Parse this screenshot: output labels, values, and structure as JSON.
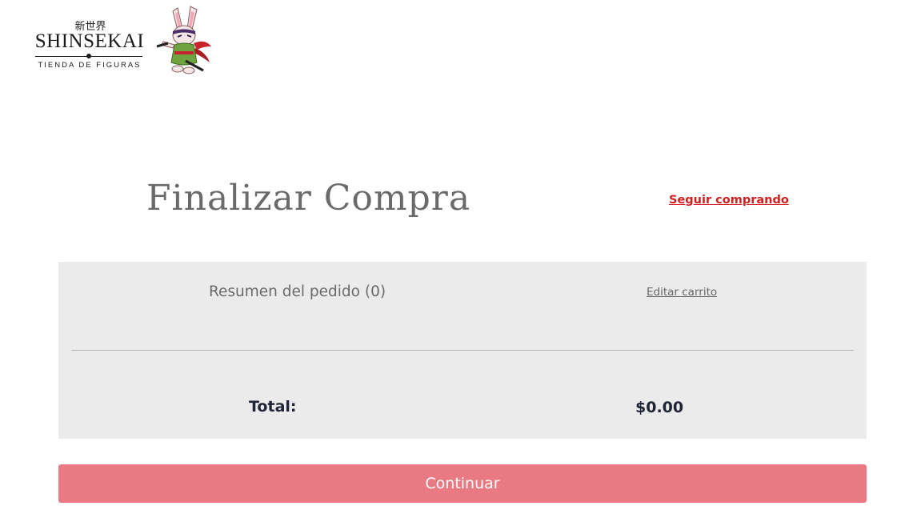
{
  "header": {
    "logo": {
      "kanji": "新世界",
      "name": "SHINSEKAI",
      "tagline": "TIENDA DE FIGURAS",
      "mascot": "rabbit-ninja-mascot"
    }
  },
  "checkout": {
    "title": "Finalizar Compra",
    "continue_shopping": "Seguir comprando"
  },
  "summary": {
    "title": "Resumen del pedido (0)",
    "edit_cart": "Editar carrito",
    "total_label": "Total:",
    "total_value": "$0.00"
  },
  "actions": {
    "continue_label": "Continuar"
  },
  "colors": {
    "link_red": "#d02020",
    "panel_bg": "#ebebeb",
    "button_bg": "#e97a84",
    "title_gray": "#6a6a6a",
    "total_text": "#1f2535"
  }
}
